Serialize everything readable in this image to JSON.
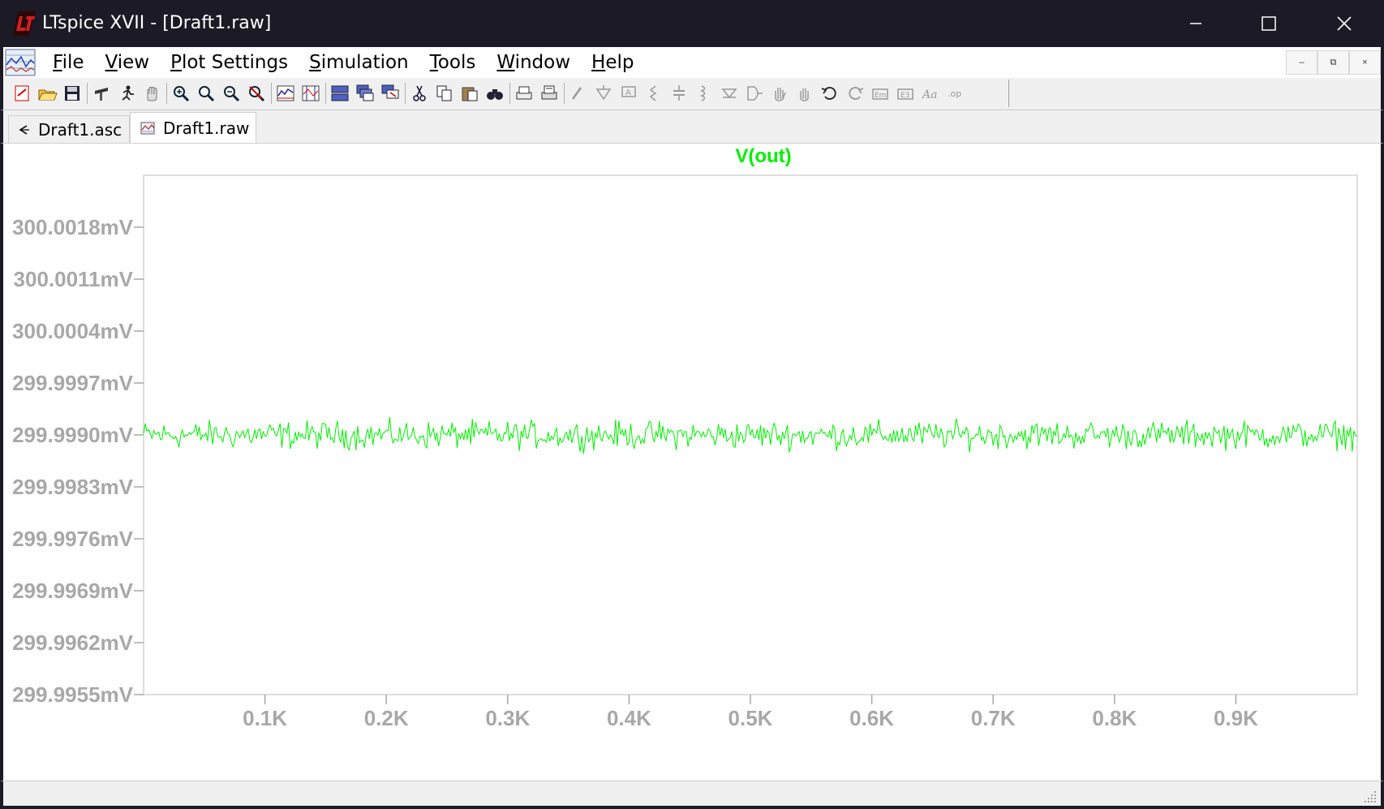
{
  "window": {
    "title": "LTspice XVII - [Draft1.raw]",
    "controls": {
      "minimize": "—",
      "maximize": "☐",
      "close": "✕"
    }
  },
  "menu": {
    "items": [
      {
        "label": "File",
        "accel": "F"
      },
      {
        "label": "View",
        "accel": "V"
      },
      {
        "label": "Plot Settings",
        "accel": "P"
      },
      {
        "label": "Simulation",
        "accel": "S"
      },
      {
        "label": "Tools",
        "accel": "T"
      },
      {
        "label": "Window",
        "accel": "W"
      },
      {
        "label": "Help",
        "accel": "H"
      }
    ],
    "mdi": {
      "minimize": "–",
      "restore": "⧉",
      "close": "×"
    }
  },
  "toolbar": {
    "icons": [
      "new-schematic-icon",
      "open-icon",
      "save-icon",
      "control-panel-icon",
      "run-icon",
      "halt-icon",
      "zoom-in-icon",
      "zoom-pan-icon",
      "zoom-out-icon",
      "zoom-fit-icon",
      "autorange-icon",
      "mark-icon",
      "tile-horizontal-icon",
      "cascade-icon",
      "tile-vertical-icon",
      "cut-icon",
      "copy-icon",
      "paste-icon",
      "find-icon",
      "print-icon",
      "print-setup-icon",
      "wire-icon",
      "ground-icon",
      "label-net-icon",
      "resistor-icon",
      "capacitor-icon",
      "inductor-icon",
      "diode-icon",
      "component-icon",
      "move-icon",
      "drag-icon",
      "undo-icon",
      "redo-icon",
      "rotate-icon",
      "mirror-icon",
      "text-icon",
      "spice-directive-icon"
    ]
  },
  "tabs": [
    {
      "label": "Draft1.asc",
      "active": false
    },
    {
      "label": "Draft1.raw",
      "active": true
    }
  ],
  "colors": {
    "trace": "#00ee00",
    "axis_text": "#a8a8a8",
    "frame": "#c8c8c8",
    "title_bar": "#1c1a24"
  },
  "chart_data": {
    "type": "line",
    "title": "V(out)",
    "xlabel": "",
    "ylabel": "",
    "x_ticks": [
      "0.1K",
      "0.2K",
      "0.3K",
      "0.4K",
      "0.5K",
      "0.6K",
      "0.7K",
      "0.8K",
      "0.9K"
    ],
    "x_tick_values": [
      100,
      200,
      300,
      400,
      500,
      600,
      700,
      800,
      900
    ],
    "xlim": [
      0,
      1000
    ],
    "y_ticks": [
      "300.0018mV",
      "300.0011mV",
      "300.0004mV",
      "299.9997mV",
      "299.9990mV",
      "299.9983mV",
      "299.9976mV",
      "299.9969mV",
      "299.9962mV",
      "299.9955mV"
    ],
    "y_tick_values": [
      300.0018,
      300.0011,
      300.0004,
      299.9997,
      299.999,
      299.9983,
      299.9976,
      299.9969,
      299.9962,
      299.9955
    ],
    "ylim": [
      299.9955,
      300.0025
    ],
    "series": [
      {
        "name": "V(out)",
        "mean": 299.999,
        "min": 299.99872,
        "max": 299.99926,
        "samples": 720
      }
    ]
  }
}
